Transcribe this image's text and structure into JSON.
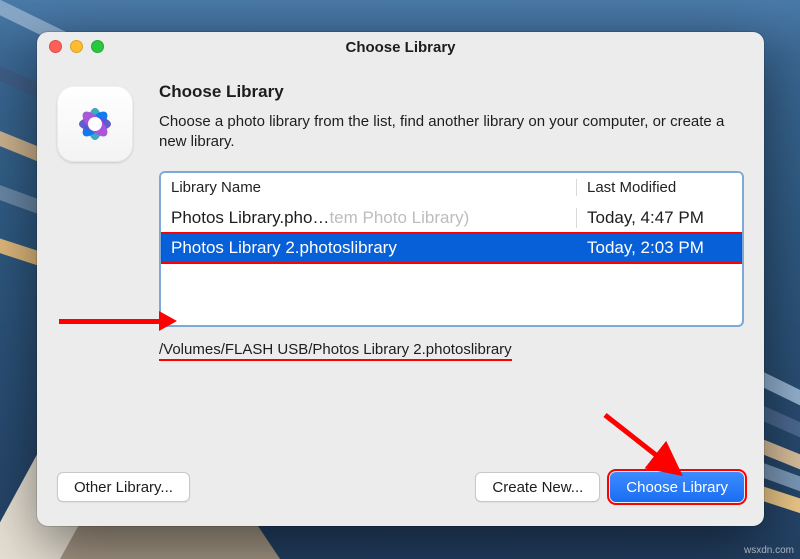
{
  "window": {
    "title": "Choose Library",
    "heading": "Choose Library",
    "subtext": "Choose a photo library from the list, find another library on your computer, or create a new library."
  },
  "table": {
    "columns": {
      "name": "Library Name",
      "modified": "Last Modified"
    },
    "rows": [
      {
        "name_prefix": "Photos Library.pho…",
        "name_suffix": "tem Photo Library)",
        "modified": "Today, 4:47 PM",
        "selected": false
      },
      {
        "name": "Photos Library 2.photoslibrary",
        "modified": "Today, 2:03 PM",
        "selected": true
      }
    ]
  },
  "path": "/Volumes/FLASH USB/Photos Library 2.photoslibrary",
  "buttons": {
    "other": "Other Library...",
    "create": "Create New...",
    "choose": "Choose Library"
  },
  "icons": {
    "photos_app": "photos-app-icon"
  },
  "watermark": "wsxdn.com"
}
